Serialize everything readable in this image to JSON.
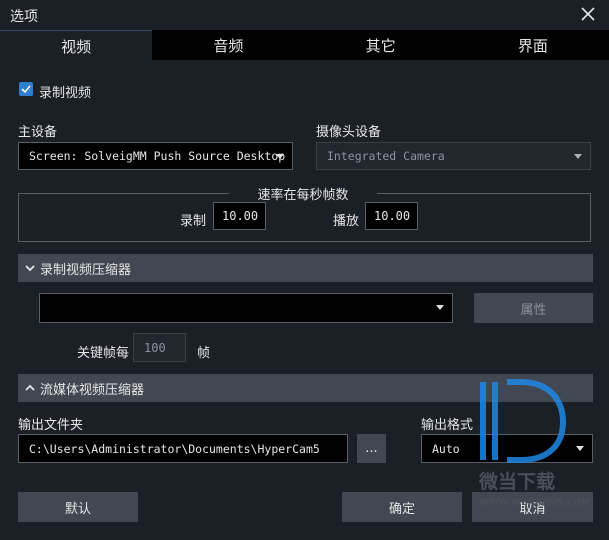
{
  "window": {
    "title": "选项"
  },
  "tabs": [
    {
      "label": "视频",
      "active": true
    },
    {
      "label": "音频",
      "active": false
    },
    {
      "label": "其它",
      "active": false
    },
    {
      "label": "界面",
      "active": false
    }
  ],
  "record_video": {
    "label": "录制视频",
    "checked": true
  },
  "main_device": {
    "label": "主设备",
    "value": "Screen: SolveigMM Push Source Desktop Fi"
  },
  "camera_device": {
    "label": "摄像头设备",
    "value": "Integrated Camera"
  },
  "rate": {
    "legend": "速率在每秒帧数",
    "record_label": "录制",
    "record_value": "10.00",
    "playback_label": "播放",
    "playback_value": "10.00"
  },
  "record_compressor": {
    "title": "录制视频压缩器",
    "value": "",
    "properties_label": "属性",
    "keyframe_label": "关键帧每",
    "keyframe_value": "100",
    "keyframe_unit": "帧"
  },
  "stream_compressor": {
    "title": "流媒体视频压缩器"
  },
  "output_folder": {
    "label": "输出文件夹",
    "value": "C:\\Users\\Administrator\\Documents\\HyperCam5",
    "browse_label": "..."
  },
  "output_format": {
    "label": "输出格式",
    "value": "Auto"
  },
  "buttons": {
    "default": "默认",
    "ok": "确定",
    "cancel": "取消"
  },
  "watermark": {
    "brand": "微当下载",
    "url": "WWW.WEIDOWN.COM"
  },
  "colors": {
    "accent": "#2e7fd0",
    "background": "#1b1f26",
    "section": "#424852",
    "watermark": "#1e88e5"
  }
}
